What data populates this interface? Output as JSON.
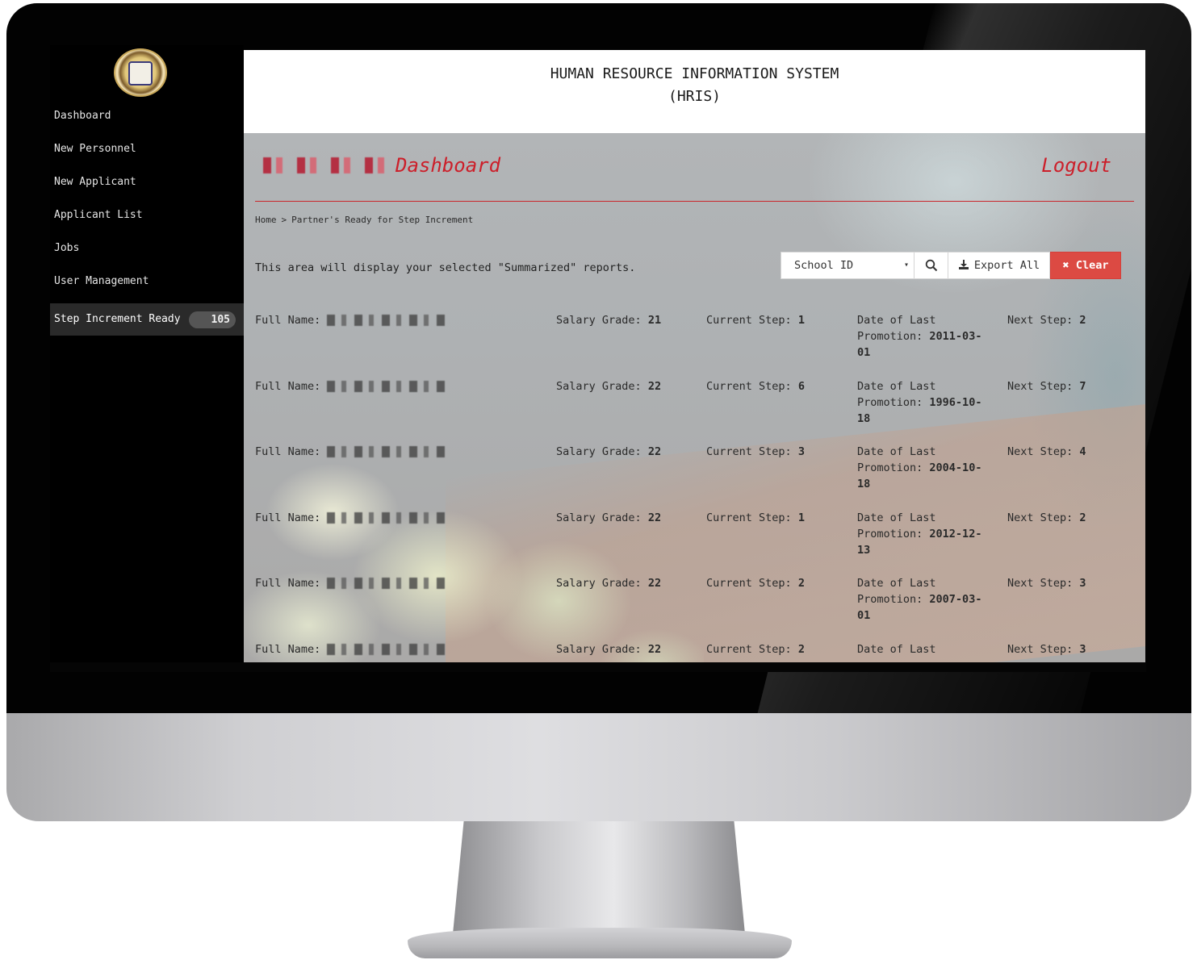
{
  "header": {
    "title_line1": "HUMAN RESOURCE INFORMATION SYSTEM",
    "title_line2": "(HRIS)"
  },
  "sidebar": {
    "items": [
      {
        "label": "Dashboard"
      },
      {
        "label": "New Personnel"
      },
      {
        "label": "New Applicant"
      },
      {
        "label": "Applicant List"
      },
      {
        "label": "Jobs"
      },
      {
        "label": "User Management"
      },
      {
        "label": "Step Increment Ready",
        "badge": "105",
        "active": true
      }
    ]
  },
  "page": {
    "title": "Dashboard",
    "logout_label": "Logout",
    "breadcrumb": [
      "Home",
      "Partner's Ready for Step Increment"
    ],
    "breadcrumb_separator": ">",
    "intro": "This area will display your selected \"Summarized\" reports."
  },
  "toolbar": {
    "select_value": "School ID",
    "export_label": "Export All",
    "clear_label": "Clear",
    "clear_color": "#dc4a43"
  },
  "labels": {
    "full_name": "Full Name:",
    "salary_grade": "Salary Grade:",
    "current_step": "Current Step:",
    "date_of_last": "Date of Last",
    "promotion": "Promotion:",
    "next_step": "Next Step:"
  },
  "records": [
    {
      "salary_grade": "21",
      "current_step": "1",
      "promotion_date": "2011-03-01",
      "next_step": "2"
    },
    {
      "salary_grade": "22",
      "current_step": "6",
      "promotion_date": "1996-10-18",
      "next_step": "7"
    },
    {
      "salary_grade": "22",
      "current_step": "3",
      "promotion_date": "2004-10-18",
      "next_step": "4"
    },
    {
      "salary_grade": "22",
      "current_step": "1",
      "promotion_date": "2012-12-13",
      "next_step": "2"
    },
    {
      "salary_grade": "22",
      "current_step": "2",
      "promotion_date": "2007-03-01",
      "next_step": "3"
    },
    {
      "salary_grade": "22",
      "current_step": "2",
      "promotion_date": "",
      "next_step": "3"
    }
  ],
  "colors": {
    "accent_red": "#cc1f2a",
    "sidebar_bg": "#000000",
    "active_item_bg": "#2a2a2a"
  }
}
